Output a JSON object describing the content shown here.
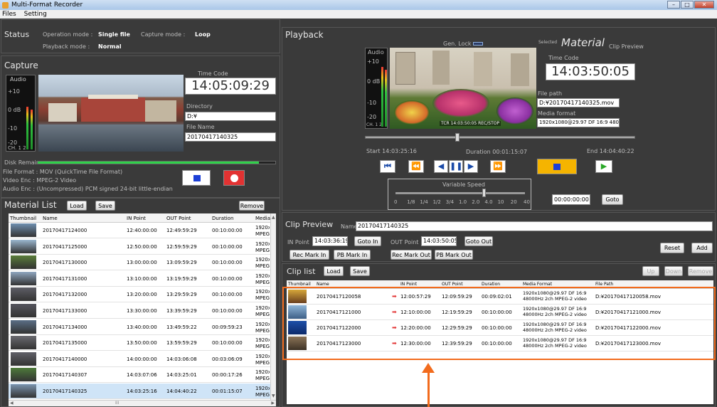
{
  "window": {
    "title": "Multi-Format Recorder"
  },
  "menu": [
    "Files",
    "Setting"
  ],
  "status": {
    "title": "Status",
    "operation_mode_label": "Operation mode :",
    "operation_mode": "Single file",
    "capture_mode_label": "Capture mode :",
    "capture_mode": "Loop",
    "playback_mode_label": "Playback mode :",
    "playback_mode": "Normal"
  },
  "capture": {
    "title": "Capture",
    "audio_label": "Audio",
    "scale": [
      "+10",
      "0 dB",
      "-10",
      "-20"
    ],
    "channel": "CH. 1 2",
    "timecode_label": "Time Code",
    "timecode": "14:05:09:29",
    "directory_label": "Directory",
    "directory": "D:¥",
    "filename_label": "File Name",
    "filename": "20170417140325",
    "disk_remain_label": "Disk Remain",
    "disk_remain_fraction": 0.93,
    "file_format": "File Format : MOV (QuickTime File Format)",
    "video_enc": "Video Enc : MPEG-2 Video",
    "audio_enc": "Audio Enc : (Uncompressed) PCM signed 24-bit little-endian"
  },
  "material_list": {
    "title": "Material List",
    "load": "Load",
    "save": "Save",
    "remove": "Remove",
    "columns": [
      "Thumbnail",
      "Name",
      "IN Point",
      "OUT Point",
      "Duration",
      "Media F"
    ],
    "rows": [
      {
        "name": "20170417124000",
        "in": "12:40:00:00",
        "out": "12:49:59:29",
        "dur": "00:10:00:00",
        "media": "1920x1 MPEG-2"
      },
      {
        "name": "20170417125000",
        "in": "12:50:00:00",
        "out": "12:59:59:29",
        "dur": "00:10:00:00",
        "media": "1920x1 MPEG-2"
      },
      {
        "name": "20170417130000",
        "in": "13:00:00:00",
        "out": "13:09:59:29",
        "dur": "00:10:00:00",
        "media": "1920x1 MPEG-2"
      },
      {
        "name": "20170417131000",
        "in": "13:10:00:00",
        "out": "13:19:59:29",
        "dur": "00:10:00:00",
        "media": "1920x1 MPEG-2"
      },
      {
        "name": "20170417132000",
        "in": "13:20:00:00",
        "out": "13:29:59:29",
        "dur": "00:10:00:00",
        "media": "1920x1 MPEG-2"
      },
      {
        "name": "20170417133000",
        "in": "13:30:00:00",
        "out": "13:39:59:29",
        "dur": "00:10:00:00",
        "media": "1920x1 MPEG-2"
      },
      {
        "name": "20170417134000",
        "in": "13:40:00:00",
        "out": "13:49:59:22",
        "dur": "00:09:59:23",
        "media": "1920x1 MPEG-2"
      },
      {
        "name": "20170417135000",
        "in": "13:50:00:00",
        "out": "13:59:59:29",
        "dur": "00:10:00:00",
        "media": "1920x1 MPEG-2"
      },
      {
        "name": "20170417140000",
        "in": "14:00:00:00",
        "out": "14:03:06:08",
        "dur": "00:03:06:09",
        "media": "1920x1 MPEG-2"
      },
      {
        "name": "20170417140307",
        "in": "14:03:07:06",
        "out": "14:03:25:01",
        "dur": "00:00:17:26",
        "media": "1920x1 MPEG-2"
      },
      {
        "name": "20170417140325",
        "in": "14:03:25:16",
        "out": "14:04:40:22",
        "dur": "00:01:15:07",
        "media": "1920x1 MPEG-2"
      }
    ],
    "scroll_mid": "III"
  },
  "playback": {
    "title": "Playback",
    "gen_lock": "Gen. Lock",
    "audio_label": "Audio",
    "scale": [
      "+10",
      "0 dB",
      "-10",
      "-20"
    ],
    "channel": "CH. 1 2",
    "overlay": "TCR 14:03:50:05 REC/STOP",
    "selected_label": "Selected",
    "material": "Material",
    "clip_preview_label": "Clip Preview",
    "timecode_label": "Time Code",
    "timecode": "14:03:50:05",
    "filepath_label": "File path",
    "filepath": "D:¥20170417140325.mov",
    "media_format_label": "Media format",
    "media_format": "1920x1080@29.97 DF 16:9 48000Hz 2c",
    "start": "Start 14:03:25:16",
    "duration": "Duration 00:01:15:07",
    "end": "End 14:04:40:22",
    "position_fraction": 0.34,
    "variable_speed": "Variable Speed",
    "speed_ticks": [
      "0",
      "1/8",
      "1/4",
      "1/2",
      "3/4",
      "1.0",
      "2.0",
      "4.0",
      "10",
      "20",
      "40"
    ],
    "speed_position_fraction": 0.68,
    "goto_tc": "00:00:00:00",
    "goto": "Goto"
  },
  "clip_preview": {
    "title": "Clip Preview",
    "name_label": "Name",
    "name": "20170417140325",
    "in_label": "IN Point",
    "in": "14:03:36:19",
    "goto_in": "Goto In",
    "out_label": "OUT Point",
    "out": "14:03:50:05",
    "goto_out": "Goto Out",
    "rec_mark_in": "Rec Mark In",
    "pb_mark_in": "PB Mark In",
    "rec_mark_out": "Rec Mark Out",
    "pb_mark_out": "PB Mark Out",
    "reset": "Reset",
    "add": "Add"
  },
  "clip_list": {
    "title": "Clip list",
    "load": "Load",
    "save": "Save",
    "up": "Up",
    "down": "Down",
    "remove": "Remove",
    "columns": [
      "Thumbnail",
      "Name",
      "IN Point",
      "OUT Point",
      "Duration",
      "Media Format",
      "File Path"
    ],
    "rows": [
      {
        "name": "20170417120058",
        "in": "12:00:57:29",
        "out": "12:09:59:29",
        "dur": "00:09:02:01",
        "media": "1920x1080@29.97 DF 16:9 48000Hz 2ch MPEG-2 video",
        "path": "D:¥20170417120058.mov"
      },
      {
        "name": "20170417121000",
        "in": "12:10:00:00",
        "out": "12:19:59:29",
        "dur": "00:10:00:00",
        "media": "1920x1080@29.97 DF 16:9 48000Hz 2ch MPEG-2 video",
        "path": "D:¥20170417121000.mov"
      },
      {
        "name": "20170417122000",
        "in": "12:20:00:00",
        "out": "12:29:59:29",
        "dur": "00:10:00:00",
        "media": "1920x1080@29.97 DF 16:9 48000Hz 2ch MPEG-2 video",
        "path": "D:¥20170417122000.mov"
      },
      {
        "name": "20170417123000",
        "in": "12:30:00:00",
        "out": "12:39:59:29",
        "dur": "00:10:00:00",
        "media": "1920x1080@29.97 DF 16:9 48000Hz 2ch MPEG-2 video",
        "path": "D:¥20170417123000.mov"
      }
    ]
  },
  "colors": {
    "accent_orange": "#f26b1d",
    "record_red": "#e23232",
    "stop_blue": "#1c3fd6",
    "play_green": "#2aa828",
    "pause_stop_yellow": "#f5b400"
  }
}
